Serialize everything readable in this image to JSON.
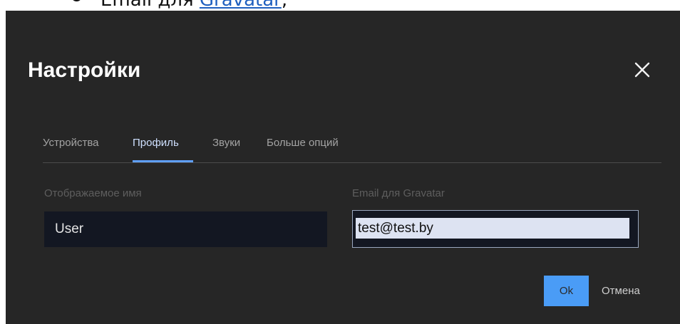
{
  "document": {
    "bullet_prefix": "Email для ",
    "bullet_link": "Gravatar",
    "bullet_suffix": ";"
  },
  "dialog": {
    "title": "Настройки",
    "close_icon": "close-icon",
    "tabs": [
      {
        "label": "Устройства",
        "active": false
      },
      {
        "label": "Профиль",
        "active": true
      },
      {
        "label": "Звуки",
        "active": false
      },
      {
        "label": "Больше опций",
        "active": false
      }
    ],
    "display_name": {
      "label": "Отображаемое имя",
      "value": "User"
    },
    "gravatar_email": {
      "label": "Email для Gravatar",
      "value": "test@test.by"
    },
    "ok_label": "Ok",
    "cancel_label": "Отмена"
  },
  "colors": {
    "dialog_background": "#262626",
    "accent": "#4a9cf6",
    "input_background": "#131722"
  }
}
